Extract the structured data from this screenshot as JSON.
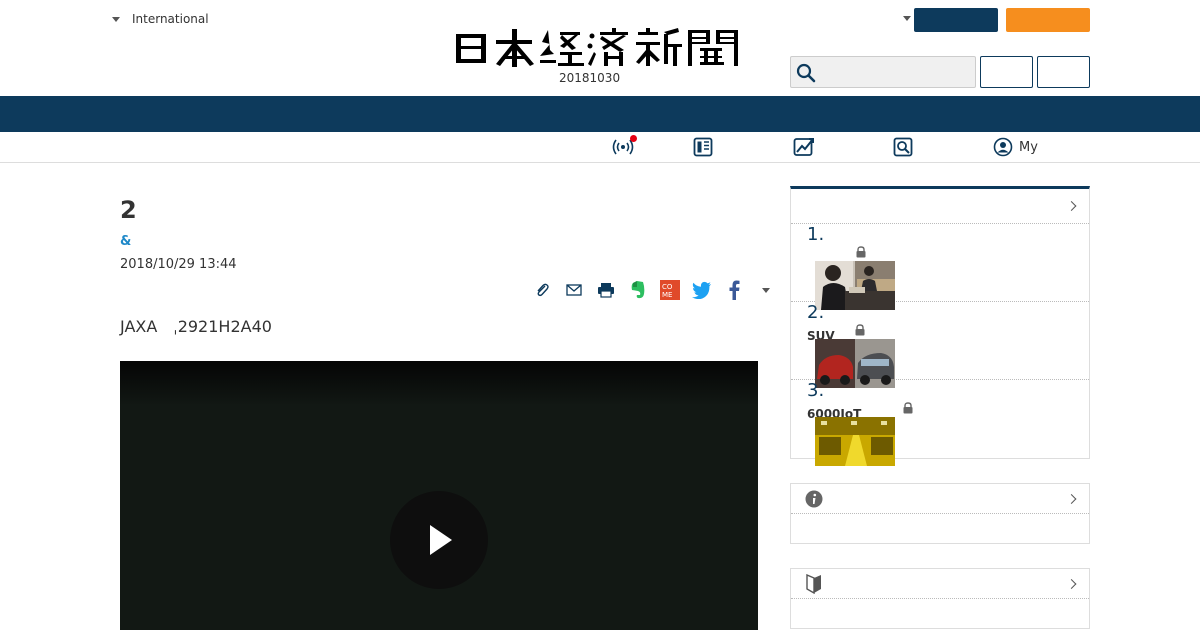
{
  "header": {
    "language_label": "International",
    "edition_date": "20181030",
    "search_placeholder": ""
  },
  "subnav": {
    "my_label": "My"
  },
  "article": {
    "title": "2",
    "category": "&",
    "date": "2018/10/29 13:44",
    "lead": "JAXA　ˌ2921H2A40"
  },
  "ranking": {
    "items": [
      {
        "num": "1.",
        "text": ""
      },
      {
        "num": "2.",
        "text": "SUV"
      },
      {
        "num": "3.",
        "text": "6000IoT"
      }
    ]
  },
  "colors": {
    "brand_navy": "#0d3a5c",
    "accent_orange": "#f68e1e",
    "link_blue": "#1e88c8",
    "twitter": "#1da1f2",
    "facebook": "#3b5998",
    "evernote": "#2dbe60",
    "comment": "#e04a2a"
  },
  "icons": [
    "search-icon",
    "live-icon",
    "paper-icon",
    "chart-icon",
    "find-icon",
    "user-icon",
    "clip-icon",
    "mail-icon",
    "print-icon",
    "evernote-icon",
    "comment-icon",
    "twitter-icon",
    "facebook-icon",
    "play-icon",
    "lock-icon",
    "info-icon",
    "beginner-icon"
  ]
}
